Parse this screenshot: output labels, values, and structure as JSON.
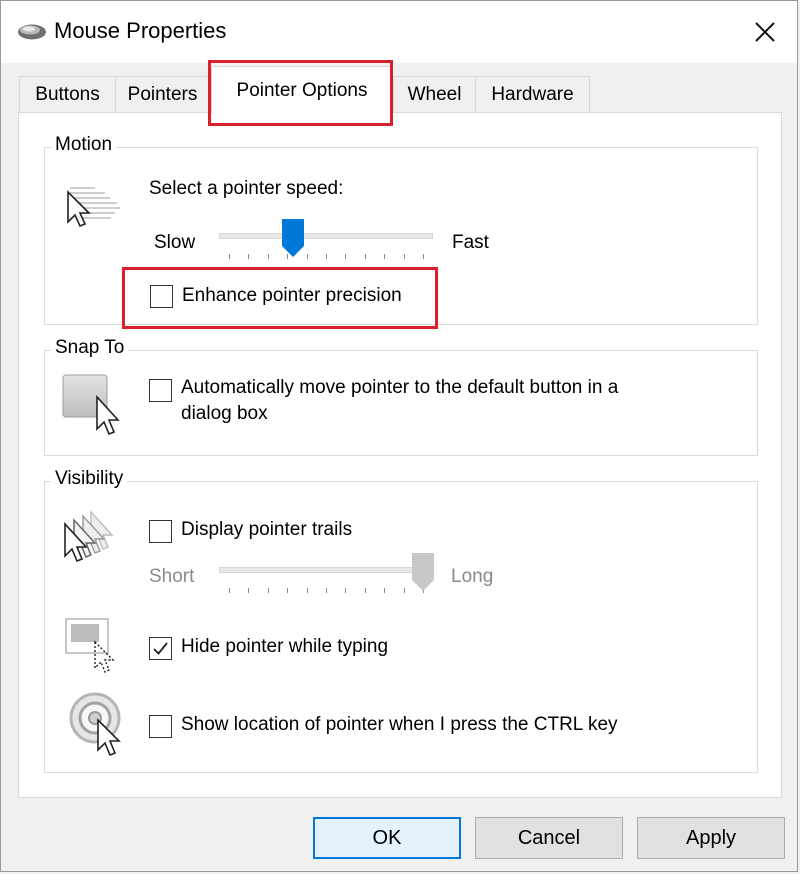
{
  "window": {
    "title": "Mouse Properties"
  },
  "tabs": [
    {
      "label": "Buttons"
    },
    {
      "label": "Pointers"
    },
    {
      "label": "Pointer Options"
    },
    {
      "label": "Wheel"
    },
    {
      "label": "Hardware"
    }
  ],
  "active_tab": "Pointer Options",
  "motion": {
    "group_label": "Motion",
    "speed_label": "Select a pointer speed:",
    "slow_label": "Slow",
    "fast_label": "Fast",
    "speed_level": 0.33,
    "precision_label": "Enhance pointer precision",
    "precision_checked": false
  },
  "snap_to": {
    "group_label": "Snap To",
    "auto_move_label_line1": "Automatically move pointer to the default button in a",
    "auto_move_label_line2": "dialog box",
    "auto_move_checked": false
  },
  "visibility": {
    "group_label": "Visibility",
    "trails_label": "Display pointer trails",
    "trails_checked": false,
    "short_label": "Short",
    "long_label": "Long",
    "trails_level": 1.0,
    "hide_label": "Hide pointer while typing",
    "hide_checked": true,
    "ctrl_label": "Show location of pointer when I press the CTRL key",
    "ctrl_checked": false
  },
  "buttons": {
    "ok": "OK",
    "cancel": "Cancel",
    "apply": "Apply"
  },
  "colors": {
    "highlight": "#d9202f",
    "slider_thumb": "#0078d7",
    "disabled_thumb": "#c8c8c8"
  }
}
